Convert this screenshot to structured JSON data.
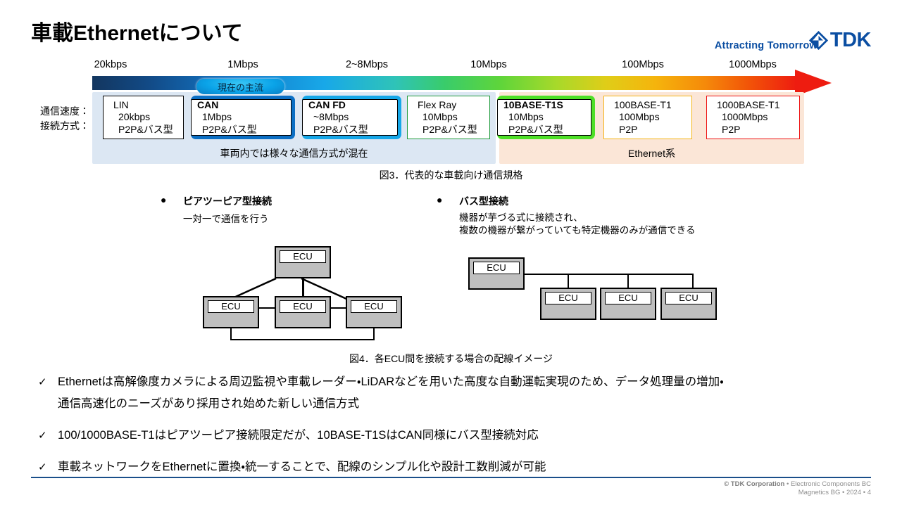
{
  "header": {
    "title": "車載Ethernetについて",
    "tagline": "Attracting Tomorrow",
    "logo_word": "TDK",
    "logo_icon": "tdk-diamond-mark"
  },
  "scale": {
    "labels": [
      "20kbps",
      "1Mbps",
      "2~8Mbps",
      "10Mbps",
      "100Mbps",
      "1000Mbps"
    ],
    "gradient_start": "#13365f",
    "gradient_end": "#ee1c10"
  },
  "axis": {
    "row1": "通信速度：",
    "row2": "接続方式："
  },
  "badge": {
    "label": "現在の主流"
  },
  "bands": [
    {
      "caption": "車両内では様々な通信方式が混在",
      "color": "#dce7f3"
    },
    {
      "caption": "Ethernet系",
      "color": "#fbe6d7"
    }
  ],
  "protocols": [
    {
      "name": "LIN",
      "speed": "20kbps",
      "topology": "P2P&バス型",
      "border": "#000000",
      "style": "thin",
      "bold": false
    },
    {
      "name": "CAN",
      "speed": "1Mbps",
      "topology": "P2P&バス型",
      "border": "#0b6fc4",
      "style": "thick",
      "bold": true
    },
    {
      "name": "CAN FD",
      "speed": "~8Mbps",
      "topology": "P2P&バス型",
      "border": "#16a7e8",
      "style": "thick",
      "bold": true
    },
    {
      "name": "Flex Ray",
      "speed": "10Mbps",
      "topology": "P2P&バス型",
      "border": "#1f9b3c",
      "style": "thin",
      "bold": false
    },
    {
      "name": "10BASE-T1S",
      "speed": "10Mbps",
      "topology": "P2P&バス型",
      "border": "#4ee027",
      "style": "thick",
      "bold": true
    },
    {
      "name": "100BASE-T1",
      "speed": "100Mbps",
      "topology": "P2P",
      "border": "#f5b416",
      "style": "thin",
      "bold": false
    },
    {
      "name": "1000BASE-T1",
      "speed": "1000Mbps",
      "topology": "P2P",
      "border": "#ee1111",
      "style": "thin",
      "bold": false
    }
  ],
  "fig3_caption": "図3．代表的な車載向け通信規格",
  "fig4_caption": "図4．各ECU間を接続する場合の配線イメージ",
  "connections": {
    "p2p": {
      "bullet": "●",
      "heading": "ピアツーピア型接続",
      "desc": "一対一で通信を行う"
    },
    "bus": {
      "bullet": "●",
      "heading": "バス型接続",
      "desc_line1": "機器が芋づる式に接続され、",
      "desc_line2": "複数の機器が繋がっていても特定機器のみが通信できる"
    }
  },
  "ecu_label": "ECU",
  "bullets": [
    {
      "check": "✓",
      "line1": "Ethernetは高解像度カメラによる周辺監視や車載レーダー・LiDARなどを用いた高度な自動運転実現のため、データ処理量の増加・",
      "line2": "通信高速化のニーズがあり採用され始めた新しい通信方式"
    },
    {
      "check": "✓",
      "line1": "100/1000BASE-T1はピアツーピア接続限定だが、10BASE-T1SはCAN同様にバス型接続対応",
      "line2": ""
    },
    {
      "check": "✓",
      "line1": "車載ネットワークをEthernetに置換・統一することで、配線のシンプル化や設計工数削減が可能",
      "line2": ""
    }
  ],
  "footer": {
    "copyright": "© TDK Corporation",
    "line1_rest": " • Electronic Components BC",
    "line2": "Magnetics BG • 2024 • 4"
  }
}
